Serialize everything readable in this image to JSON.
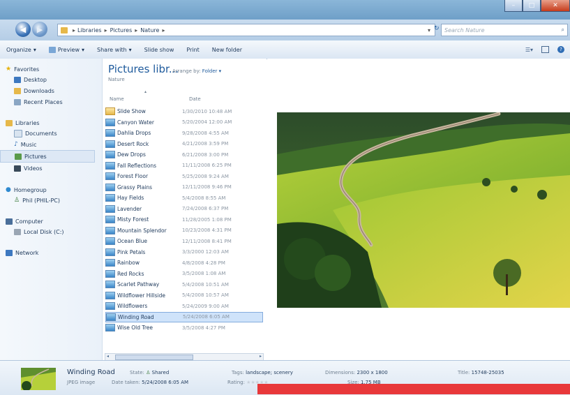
{
  "address": {
    "crumbs": [
      "Libraries",
      "Pictures",
      "Nature"
    ],
    "search_placeholder": "Search Nature"
  },
  "toolbar": {
    "organize": "Organize",
    "preview": "Preview",
    "share_with": "Share with",
    "slide_show": "Slide show",
    "print": "Print",
    "new_folder": "New folder"
  },
  "sidebar": {
    "favorites": {
      "label": "Favorites",
      "items": [
        "Desktop",
        "Downloads",
        "Recent Places"
      ]
    },
    "libraries": {
      "label": "Libraries",
      "items": [
        "Documents",
        "Music",
        "Pictures",
        "Videos"
      ]
    },
    "homegroup": {
      "label": "Homegroup",
      "items": [
        "Phil (PHIL-PC)"
      ]
    },
    "computer": {
      "label": "Computer",
      "items": [
        "Local Disk (C:)"
      ]
    },
    "network": {
      "label": "Network"
    }
  },
  "library": {
    "title": "Pictures libr...",
    "subtitle": "Nature",
    "arrange_label": "Arrange by:",
    "arrange_value": "Folder",
    "col_name": "Name",
    "col_date": "Date"
  },
  "files": [
    {
      "name": "Slide Show",
      "date": "1/30/2010 10:48 AM",
      "type": "folder"
    },
    {
      "name": "Canyon Water",
      "date": "5/20/2004 12:00 AM"
    },
    {
      "name": "Dahlia Drops",
      "date": "9/28/2008 4:55 AM"
    },
    {
      "name": "Desert Rock",
      "date": "4/21/2008 3:59 PM"
    },
    {
      "name": "Dew Drops",
      "date": "6/21/2008 3:00 PM"
    },
    {
      "name": "Fall Reflections",
      "date": "11/11/2008 6:25 PM"
    },
    {
      "name": "Forest Floor",
      "date": "5/25/2008 9:24 AM"
    },
    {
      "name": "Grassy Plains",
      "date": "12/11/2008 9:46 PM"
    },
    {
      "name": "Hay Fields",
      "date": "5/4/2008 8:55 AM"
    },
    {
      "name": "Lavender",
      "date": "7/24/2008 6:37 PM"
    },
    {
      "name": "Misty Forest",
      "date": "11/28/2005 1:08 PM"
    },
    {
      "name": "Mountain Splendor",
      "date": "10/23/2008 4:31 PM"
    },
    {
      "name": "Ocean Blue",
      "date": "12/11/2008 8:41 PM"
    },
    {
      "name": "Pink Petals",
      "date": "3/3/2000 12:03 AM"
    },
    {
      "name": "Rainbow",
      "date": "4/8/2008 4:28 PM"
    },
    {
      "name": "Red Rocks",
      "date": "3/5/2008 1:08 AM"
    },
    {
      "name": "Scarlet Pathway",
      "date": "5/4/2008 10:51 AM"
    },
    {
      "name": "Wildflower Hillside",
      "date": "5/4/2008 10:57 AM"
    },
    {
      "name": "Wildflowers",
      "date": "5/24/2009 9:00 AM"
    },
    {
      "name": "Winding Road",
      "date": "5/24/2008 6:05 AM",
      "selected": true
    },
    {
      "name": "Wise Old Tree",
      "date": "3/5/2008 4:27 PM"
    }
  ],
  "details": {
    "name": "Winding Road",
    "type": "JPEG image",
    "state_label": "State:",
    "state_value": "Shared",
    "date_label": "Date taken:",
    "date_value": "5/24/2008 6:05 AM",
    "tags_label": "Tags:",
    "tags_value": "landscape; scenery",
    "rating_label": "Rating:",
    "dim_label": "Dimensions:",
    "dim_value": "2300 x 1800",
    "size_label": "Size:",
    "size_value": "1.75 MB",
    "title_label": "Title:",
    "title_value": "15748-25035"
  },
  "colors": {
    "accent": "#1e5a9c",
    "selection": "#cfe3fa",
    "overlay_red": "#e8383a"
  }
}
